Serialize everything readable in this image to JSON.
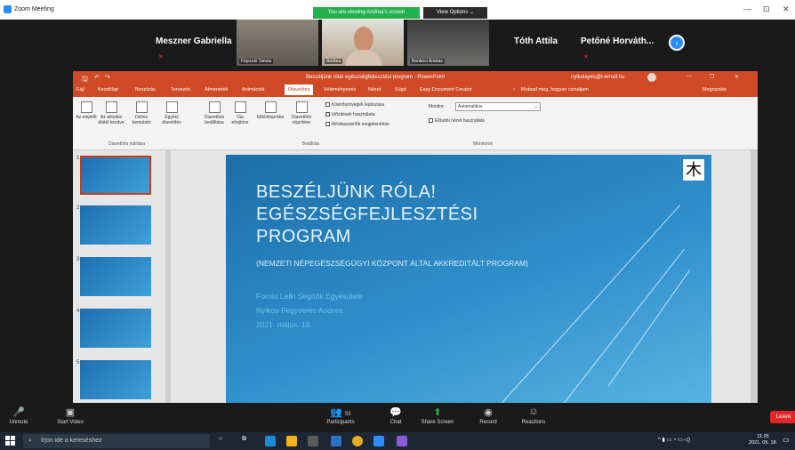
{
  "zoom": {
    "window_title": "Zoom Meeting",
    "viewing_banner": "You are viewing Andrea's screen",
    "view_options": "View Options ⌄",
    "minimize": "—",
    "maximize": "⊡",
    "close": "✕",
    "participants_strip": [
      {
        "name": "Meszner Gabriella",
        "type": "name"
      },
      {
        "name": "Fejeczki Tamás",
        "type": "video"
      },
      {
        "name": "Andrea",
        "type": "video"
      },
      {
        "name": "Benkovi András",
        "type": "video"
      },
      {
        "name": "Tóth Attila",
        "type": "name"
      },
      {
        "name": "Petőné Horváth...",
        "type": "name"
      }
    ],
    "next_page_icon": "chevron-right-icon",
    "controls": {
      "unmute": "Unmute",
      "start_video": "Start Video",
      "participants": "Participants",
      "participants_count": "55",
      "chat": "Chat",
      "share_screen": "Share Screen",
      "record": "Record",
      "reactions": "Reactions",
      "leave": "Leave"
    }
  },
  "powerpoint": {
    "title": "Beszéljünk róla! egészségfejlesztési program - PowerPoint",
    "user_email": "nyikolayes@t-email.hu",
    "tabs": [
      "Fájl",
      "Kezdőlap",
      "Beszúrás",
      "Tervezés",
      "Átmenetek",
      "Animációk",
      "Diavetítés",
      "Véleményezés",
      "Nézet",
      "Súgó",
      "Easy Document Creator"
    ],
    "active_tab": "Diavetítés",
    "tell_me": "Mutasd meg, hogyan csináljam",
    "share": "Megosztás",
    "ribbon": {
      "start_beginning": "Az elejétől",
      "start_current": "Az aktuális diától kezdve",
      "online_present": "Online bemutató",
      "custom_show": "Egyéni diavetítés",
      "group_start": "Diavetítés indítása",
      "setup_show": "Diavetítés beállítása",
      "hide_slide": "Dia elrejtése",
      "rehearse": "Időzítéspróba",
      "record": "Diavetítés rögzítése",
      "chk_narration": "Kísérőszövegek lejátszása",
      "chk_timings": "Időzítések használata",
      "chk_media": "Médiavezérlők megjelenítése",
      "group_setup": "Beállítás",
      "monitor_label": "Monitor:",
      "monitor_value": "Automatikus",
      "presenter_view": "Előadói nézet használata",
      "group_monitors": "Monitorok"
    },
    "slide_numbers": [
      "1",
      "2",
      "3",
      "4",
      "5"
    ],
    "slide": {
      "title_lines": [
        "BESZÉLJÜNK RÓLA!",
        "EGÉSZSÉGFEJLESZTÉSI",
        "PROGRAM"
      ],
      "subtitle": "(NEMZETI NÉPEGÉSZSÉGÜGYI KÖZPONT ÁLTAL AKKREDITÁLT PROGRAM)",
      "org": "Forrás Lelki Segítők Egyesülete",
      "author": "Nyikos-Fegyveres Andrea",
      "date": "2021. május. 18."
    }
  },
  "taskbar": {
    "search_placeholder": "Írjon ide a kereséshez",
    "time": "11:25",
    "date": "2021. 05. 18."
  }
}
